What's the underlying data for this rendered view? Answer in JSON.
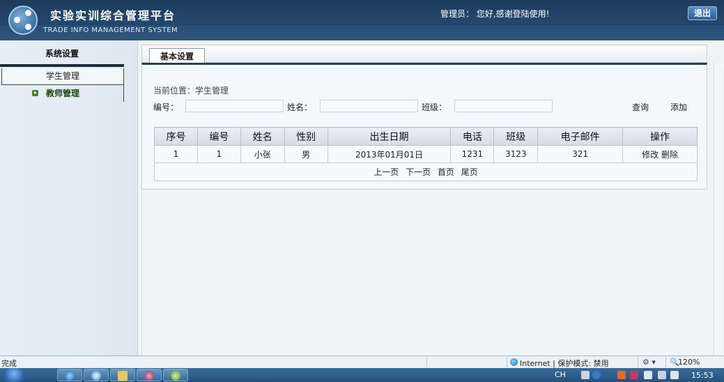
{
  "header": {
    "title": "实验实训综合管理平台",
    "subtitle": "TRADE INFO MANAGEMENT SYSTEM",
    "welcome": "管理员： 您好,感谢登陆使用!",
    "logout_label": "退出"
  },
  "sidebar": {
    "title": "系统设置",
    "items": [
      {
        "label": "学生管理"
      },
      {
        "label": "教师管理"
      }
    ]
  },
  "main": {
    "tab_label": "基本设置",
    "breadcrumb": "当前位置：学生管理",
    "search": {
      "id_label": "编号：",
      "name_label": "姓名：",
      "class_label": "班级：",
      "query_label": "查询",
      "add_label": "添加"
    },
    "table": {
      "headers": [
        "序号",
        "编号",
        "姓名",
        "性别",
        "出生日期",
        "电话",
        "班级",
        "电子邮件",
        "操作"
      ],
      "rows": [
        {
          "seq": "1",
          "id": "1",
          "name": "小张",
          "gender": "男",
          "birth": "2013年01月01日",
          "phone": "1231",
          "class": "3123",
          "email": "321",
          "edit": "修改",
          "delete": "删除"
        }
      ],
      "pager": {
        "prev": "上一页",
        "next": "下一页",
        "first": "首页",
        "last": "尾页"
      }
    }
  },
  "statusbar": {
    "status": "完成",
    "zone": "Internet | 保护模式: 禁用",
    "zoom": "120%"
  },
  "taskbar": {
    "lang": "CH",
    "clock": "15:53"
  }
}
